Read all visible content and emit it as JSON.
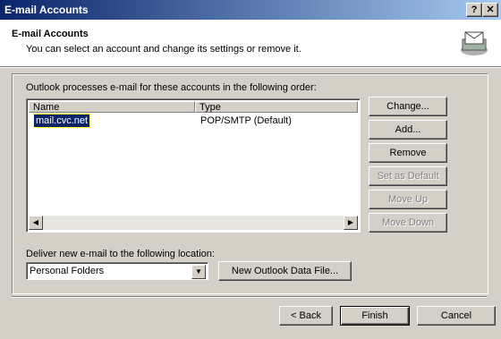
{
  "window": {
    "title": "E-mail Accounts",
    "help_label": "?",
    "close_label": "✕"
  },
  "header": {
    "title": "E-mail Accounts",
    "subtitle": "You can select an account and change its settings or remove it."
  },
  "accounts": {
    "caption": "Outlook processes e-mail for these accounts in the following order:",
    "columns": [
      "Name",
      "Type"
    ],
    "rows": [
      {
        "name": "mail.cvc.net",
        "type": "POP/SMTP (Default)"
      }
    ]
  },
  "side_buttons": {
    "change": "Change...",
    "add": "Add...",
    "remove": "Remove",
    "set_default": "Set as Default",
    "move_up": "Move Up",
    "move_down": "Move Down"
  },
  "deliver": {
    "label": "Deliver new e-mail to the following location:",
    "selected": "Personal Folders",
    "new_file_button": "New Outlook Data File..."
  },
  "footer": {
    "back": "< Back",
    "finish": "Finish",
    "cancel": "Cancel"
  }
}
